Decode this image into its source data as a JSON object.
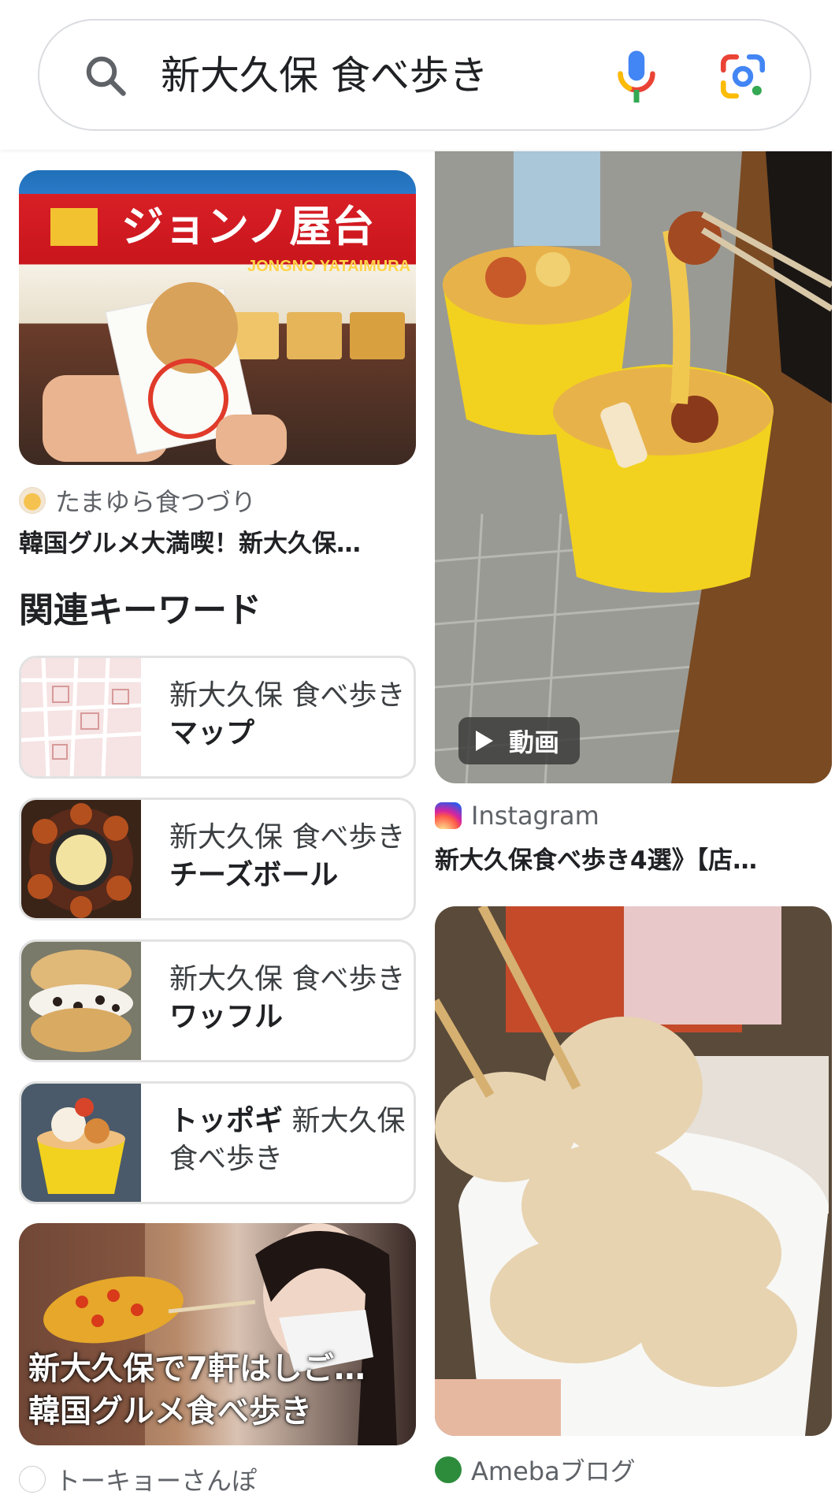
{
  "search": {
    "query": "新大久保 食べ歩き"
  },
  "results": [
    {
      "source": "たまゆら食つづり",
      "title": "韓国グルメ大満喫！新大久保…"
    },
    {
      "source": "Instagram",
      "title": "新大久保食べ歩き4選》【店…",
      "badge": "動画"
    },
    {
      "source": "トーキョーさんぽ",
      "overlay_line1": "新大久保で7軒はしご…",
      "overlay_line2": "韓国グルメ食べ歩き"
    },
    {
      "source": "Amebaブログ"
    }
  ],
  "related": {
    "heading": "関連キーワード",
    "items": [
      {
        "prefix": "新大久保 食べ歩き",
        "bold": "マップ"
      },
      {
        "prefix": "新大久保 食べ歩き",
        "bold": "チーズボール"
      },
      {
        "prefix": "新大久保 食べ歩き",
        "bold": "ワッフル"
      },
      {
        "bold": "トッポギ",
        "suffix": "新大久保 食べ歩き"
      }
    ]
  },
  "image_banner_text": {
    "store_name": "ジョンノ屋台",
    "store_name_roman": "JONGNO YATAIMURA"
  },
  "colors": {
    "brand_blue": "#4285F4",
    "brand_red": "#EA4335",
    "brand_yellow": "#FBBC05",
    "brand_green": "#34A853",
    "border": "#dadce0"
  }
}
